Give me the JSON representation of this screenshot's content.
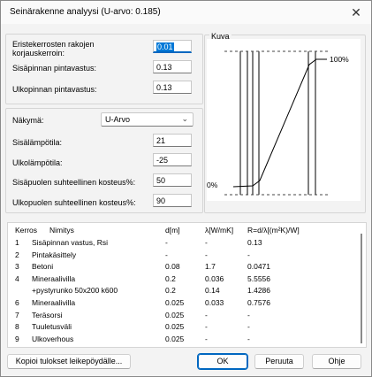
{
  "window": {
    "title": "Seinärakenne analyysi (U-arvo: 0.185)",
    "close_glyph": "✕"
  },
  "params": {
    "correction_label": "Eristekerrosten rakojen korjauskerroin:",
    "correction_value": "0.01",
    "inner_resistance_label": "Sisäpinnan pintavastus:",
    "inner_resistance_value": "0.13",
    "outer_resistance_label": "Ulkopinnan pintavastus:",
    "outer_resistance_value": "0.13"
  },
  "view": {
    "view_label": "Näkymä:",
    "view_value": "U-Arvo",
    "inner_temp_label": "Sisälämpötila:",
    "inner_temp_value": "21",
    "outer_temp_label": "Ulkolämpötila:",
    "outer_temp_value": "-25",
    "inner_rh_label": "Sisäpuolen suhteellinen kosteus%:",
    "inner_rh_value": "50",
    "outer_rh_label": "Ulkopuolen suhteellinen kosteus%:",
    "outer_rh_value": "90"
  },
  "picture": {
    "label": "Kuva",
    "top_label": "100%",
    "bottom_label": "0%"
  },
  "table": {
    "headers": [
      "Kerros",
      "Nimitys",
      "d[m]",
      "λ[W/mK]",
      "R=d/λ[(m²K)/W]"
    ],
    "rows": [
      [
        "1",
        "Sisäpinnan vastus, Rsi",
        "-",
        "-",
        "0.13"
      ],
      [
        "2",
        "Pintakäsittely",
        "-",
        "-",
        "-"
      ],
      [
        "3",
        "Betoni",
        "0.08",
        "1.7",
        "0.0471"
      ],
      [
        "4",
        "Mineraalivilla",
        "0.2",
        "0.036",
        "5.5556"
      ],
      [
        "",
        "+pystyrunko 50x200 k600",
        "0.2",
        "0.14",
        "1.4286"
      ],
      [
        "6",
        "Mineraalivilla",
        "0.025",
        "0.033",
        "0.7576"
      ],
      [
        "7",
        "Teräsorsi",
        "0.025",
        "-",
        "-"
      ],
      [
        "8",
        "Tuuletusväli",
        "0.025",
        "-",
        "-"
      ],
      [
        "9",
        "Ulkoverhous",
        "0.025",
        "-",
        "-"
      ]
    ]
  },
  "buttons": {
    "copy": "Kopioi tulokset leikepöydälle...",
    "ok": "OK",
    "cancel": "Peruuta",
    "help": "Ohje"
  }
}
